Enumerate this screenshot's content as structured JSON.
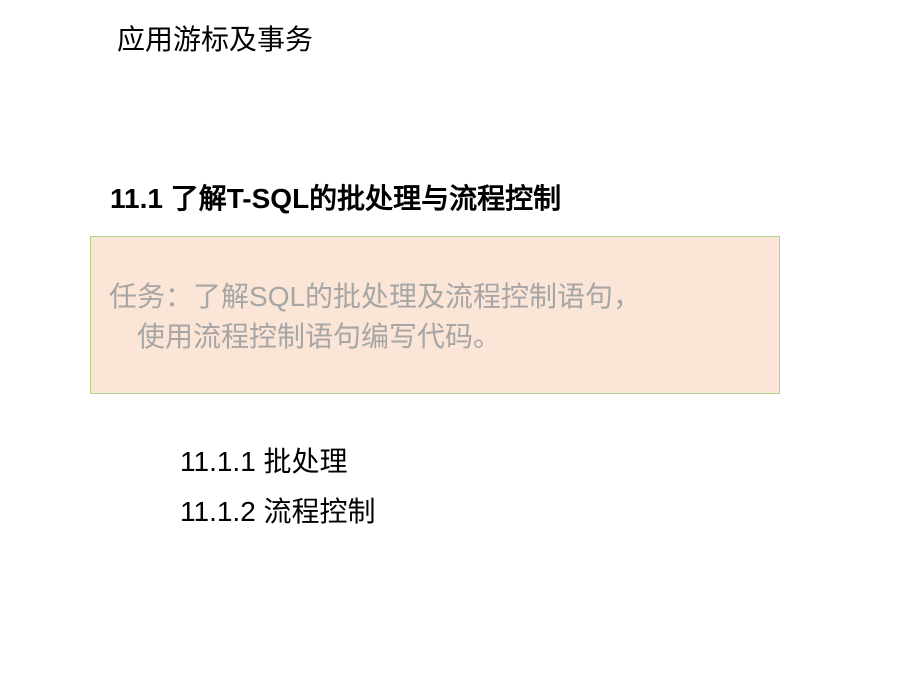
{
  "page_title": "应用游标及事务",
  "section_heading": "11.1  了解T-SQL的批处理与流程控制",
  "task": {
    "label": "任务：",
    "line1": "了解SQL的批处理及流程控制语句，",
    "line2": "使用流程控制语句编写代码。"
  },
  "subsections": [
    "11.1.1   批处理",
    "11.1.2   流程控制"
  ]
}
